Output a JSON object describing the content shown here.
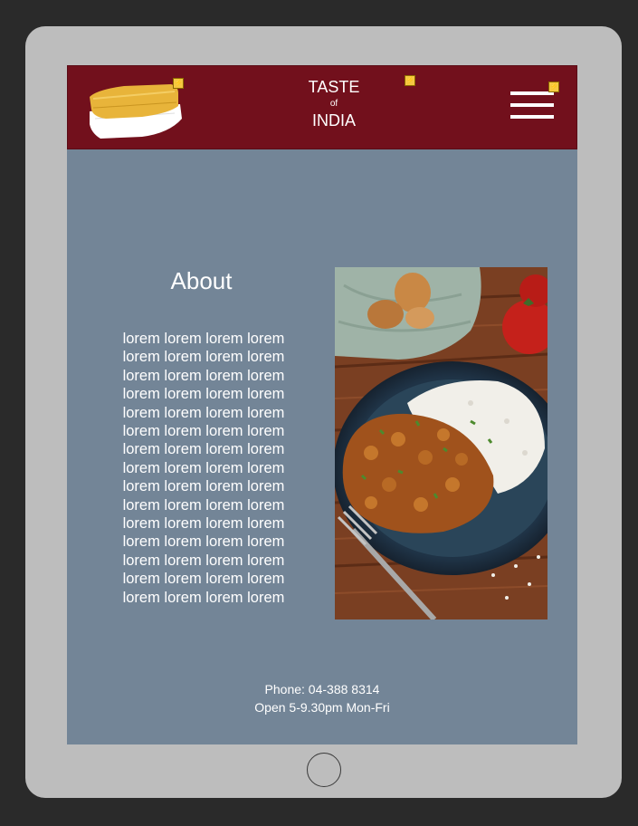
{
  "header": {
    "title_line1": "TASTE",
    "title_line2": "of",
    "title_line3": "INDIA",
    "badge_glyph": "⚡",
    "brand_color": "#72101c",
    "logo_icon": "food-container-icon",
    "menu_icon": "hamburger-menu-icon"
  },
  "about": {
    "heading": "About",
    "lines": [
      "lorem lorem lorem lorem",
      "lorem lorem lorem lorem",
      "lorem lorem lorem lorem",
      "lorem lorem lorem lorem",
      "lorem lorem lorem lorem",
      "lorem lorem lorem lorem",
      "lorem lorem lorem lorem",
      "lorem lorem lorem lorem",
      "lorem lorem lorem lorem",
      "lorem lorem lorem lorem",
      "lorem lorem lorem lorem",
      "lorem lorem lorem lorem",
      "lorem lorem lorem lorem",
      "lorem lorem lorem lorem",
      "lorem lorem lorem lorem"
    ]
  },
  "footer": {
    "phone": "Phone: 04-388 8314",
    "hours": "Open 5-9.30pm Mon-Fri"
  },
  "colors": {
    "page_bg": "#738597",
    "device_frame": "#bdbdbd"
  }
}
